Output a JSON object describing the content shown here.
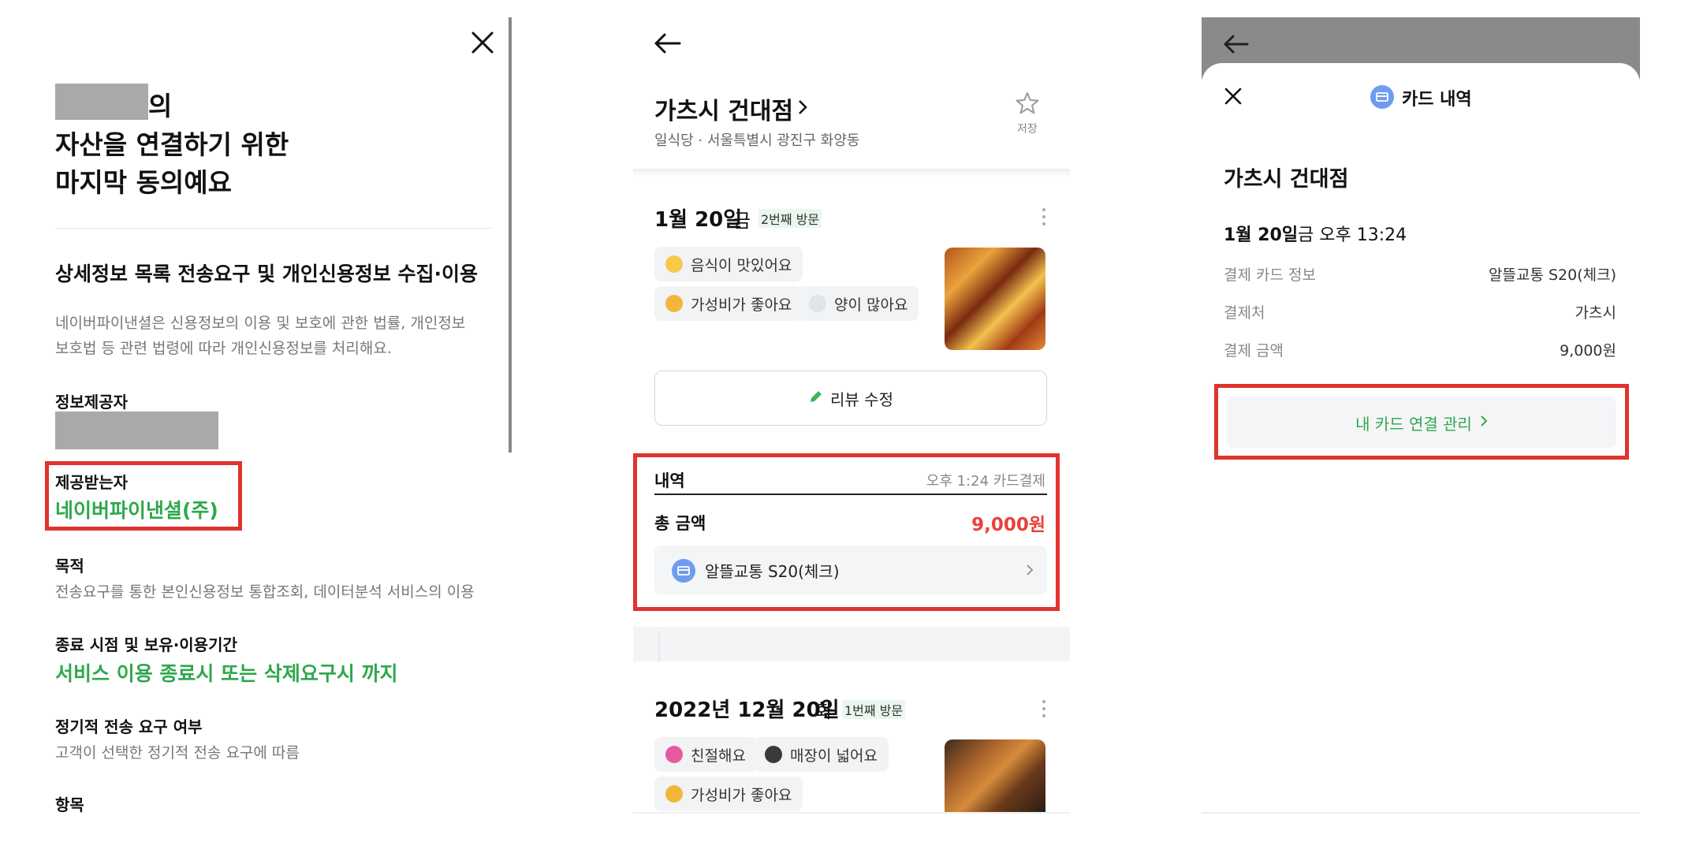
{
  "left": {
    "title_suffix": "의",
    "title_line2": "자산을 연결하기 위한",
    "title_line3": "마지막 동의예요",
    "section_title": "상세정보 목록 전송요구 및 개인신용정보 수집·이용",
    "desc_line1": "네이버파이낸셜은 신용정보의 이용 및 보호에 관한 법률, 개인정보",
    "desc_line2": "보호법 등 관련 법령에 따라 개인신용정보를 처리해요.",
    "provider_label": "정보제공자",
    "recipient_label": "제공받는자",
    "recipient_value": "네이버파이낸셜(주)",
    "purpose_label": "목적",
    "purpose_value": "전송요구를 통한 본인신용정보 통합조회, 데이터분석 서비스의 이용",
    "period_label": "종료 시점 및 보유·이용기간",
    "period_value": "서비스 이용 종료시 또는 삭제요구시 까지",
    "regular_label": "정기적 전송 요구 여부",
    "regular_value": "고객이 선택한 정기적 전송 요구에 따름",
    "items_label": "항목"
  },
  "middle": {
    "store_name": "가츠시 건대점",
    "store_meta": "일식당 · 서울특별시 광진구 화양동",
    "save_label": "저장",
    "visit1": {
      "date": "1월 20일",
      "weekday": "금",
      "count": "2번째 방문",
      "tags": [
        "음식이 맛있어요",
        "가성비가 좋아요",
        "양이 많아요"
      ]
    },
    "edit_review_label": "리뷰 수정",
    "history": {
      "label": "내역",
      "time_info": "오후 1:24 카드결제",
      "total_label": "총 금액",
      "total_value": "9,000원",
      "card_name": "알뜰교통 S20(체크)"
    },
    "visit2": {
      "date": "2022년 12월 20일",
      "weekday": "화",
      "count": "1번째 방문",
      "tags": [
        "친절해요",
        "매장이 넓어요",
        "가성비가 좋아요"
      ]
    }
  },
  "right": {
    "sheet_title": "카드 내역",
    "store_name": "가츠시 건대점",
    "date": "1월 20일",
    "date_rest": "금 오후 13:24",
    "rows": [
      {
        "label": "결제 카드 정보",
        "value": "알뜰교통 S20(체크)"
      },
      {
        "label": "결제처",
        "value": "가츠시"
      },
      {
        "label": "결제 금액",
        "value": "9,000원"
      }
    ],
    "manage_button": "내 카드 연결 관리"
  },
  "colors": {
    "accent_green": "#2ea84c",
    "highlight_red": "#e0332e",
    "price_red": "#e8413b",
    "card_icon_blue": "#6f9cf0"
  }
}
